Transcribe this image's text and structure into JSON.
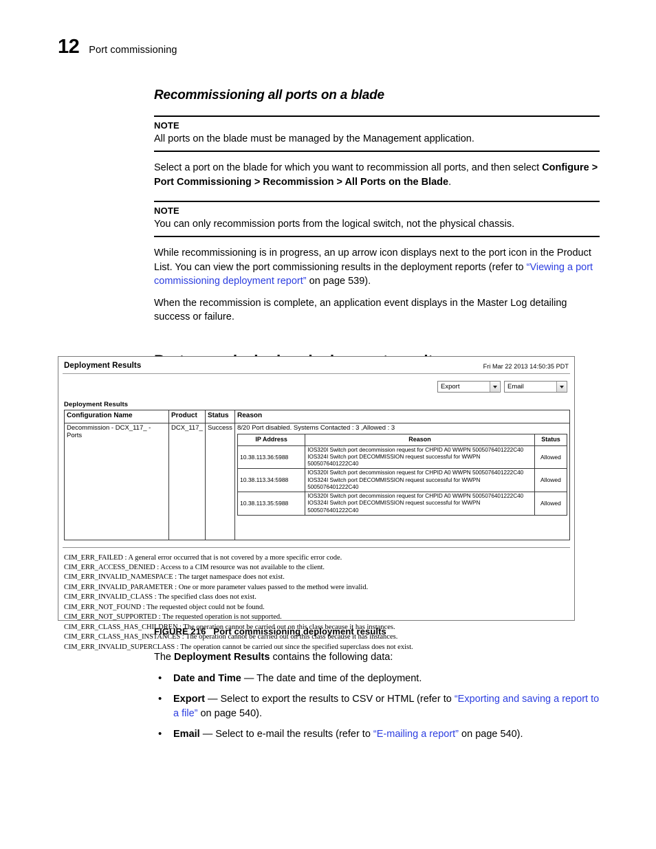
{
  "page": {
    "number": "12",
    "running_head": "Port commissioning"
  },
  "section": {
    "heading": "Recommissioning all ports on a blade"
  },
  "notes": [
    {
      "label": "NOTE",
      "text": "All ports on the blade must be managed by the Management application."
    },
    {
      "label": "NOTE",
      "text": "You can only recommission ports from the logical switch, not the physical chassis."
    }
  ],
  "paragraphs": {
    "select_port": {
      "lead": "Select a port on the blade for which you want to recommission all ports, and then select ",
      "menu_path": "Configure > Port Commissioning > Recommission > All Ports on the Blade",
      "tail": "."
    },
    "progress": {
      "part1": "While recommissioning is in progress, an up arrow icon displays next to the port icon in the Product List. You can view the port commissioning results in the deployment reports (refer to ",
      "link": "“Viewing a port commissioning deployment report”",
      "part2": " on page 539)."
    },
    "complete": "When the recommission is complete, an application event displays in the Master Log detailing success or failure."
  },
  "chapter_heading": "Port commissioning deployment results",
  "screenshot": {
    "title": "Deployment Results",
    "timestamp": "Fri Mar 22 2013 14:50:35 PDT",
    "controls": [
      {
        "name": "export-dropdown",
        "value": "Export"
      },
      {
        "name": "email-dropdown",
        "value": "Email"
      }
    ],
    "table_label": "Deployment Results",
    "outer_headers": [
      "Configuration Name",
      "Product",
      "Status",
      "Reason"
    ],
    "outer_row": {
      "configuration_name": "Decommission - DCX_117_ - Ports",
      "product": "DCX_117_",
      "status": "Success",
      "reason_summary": "8/20 Port disabled. Systems Contacted : 3 ,Allowed : 3"
    },
    "inner_headers": [
      "IP Address",
      "Reason",
      "Status"
    ],
    "inner_rows": [
      {
        "ip": "10.38.113.36:5988",
        "reason_line1": "IOS320I Switch port decommission request for CHPID A0 WWPN 5005076401222C40",
        "reason_line2": "IOS324I Switch port DECOMMISSION request successful for WWPN 5005076401222C40",
        "status": "Allowed"
      },
      {
        "ip": "10.38.113.34:5988",
        "reason_line1": "IOS320I Switch port decommission request for CHPID A0 WWPN 5005076401222C40",
        "reason_line2": "IOS324I Switch port DECOMMISSION request successful for WWPN 5005076401222C40",
        "status": "Allowed"
      },
      {
        "ip": "10.38.113.35:5988",
        "reason_line1": "IOS320I Switch port decommission request for CHPID A0 WWPN 5005076401222C40",
        "reason_line2": "IOS324I Switch port DECOMMISSION request successful for WWPN 5005076401222C40",
        "status": "Allowed"
      }
    ],
    "cim_errors": [
      {
        "code": "CIM_ERR_FAILED",
        "desc": " : A general error occurred that is not covered by a more specific error code."
      },
      {
        "code": "CIM_ERR_ACCESS_DENIED",
        "desc": " : Access to a CIM resource was not available to the client."
      },
      {
        "code": "CIM_ERR_INVALID_NAMESPACE",
        "desc": " : The target namespace does not exist."
      },
      {
        "code": "CIM_ERR_INVALID_PARAMETER",
        "desc": " : One or more parameter values passed to the method were invalid."
      },
      {
        "code": "CIM_ERR_INVALID_CLASS",
        "desc": " : The specified class does not exist."
      },
      {
        "code": "CIM_ERR_NOT_FOUND",
        "desc": " : The requested object could not be found."
      },
      {
        "code": "CIM_ERR_NOT_SUPPORTED",
        "desc": " : The requested operation is not supported."
      },
      {
        "code": "CIM_ERR_CLASS_HAS_CHILDREN",
        "desc": " : The operation cannot be carried out on this class because it has instances."
      },
      {
        "code": "CIM_ERR_CLASS_HAS_INSTANCES",
        "desc": " : The operation cannot be carried out on this class because it has instances."
      },
      {
        "code": "CIM_ERR_INVALID_SUPERCLASS",
        "desc": " : The operation cannot be carried out since the specified superclass does not exist."
      }
    ]
  },
  "figure": {
    "number": "FIGURE 216",
    "caption": "Port commissioning deployment results"
  },
  "trailing": {
    "intro_pre": "The ",
    "intro_bold": "Deployment Results",
    "intro_post": " contains the following data:",
    "bullets": [
      {
        "term": "Date and Time",
        "sep": " — ",
        "text": "The date and time of the deployment.",
        "link": "",
        "text2": ""
      },
      {
        "term": "Export",
        "sep": " — ",
        "text": "Select to export the results to CSV or HTML (refer to ",
        "link": "“Exporting and saving a report to a file”",
        "text2": " on page 540)."
      },
      {
        "term": "Email",
        "sep": " — ",
        "text": "Select to e-mail the results (refer to ",
        "link": "“E-mailing a report”",
        "text2": " on page 540)."
      }
    ]
  }
}
